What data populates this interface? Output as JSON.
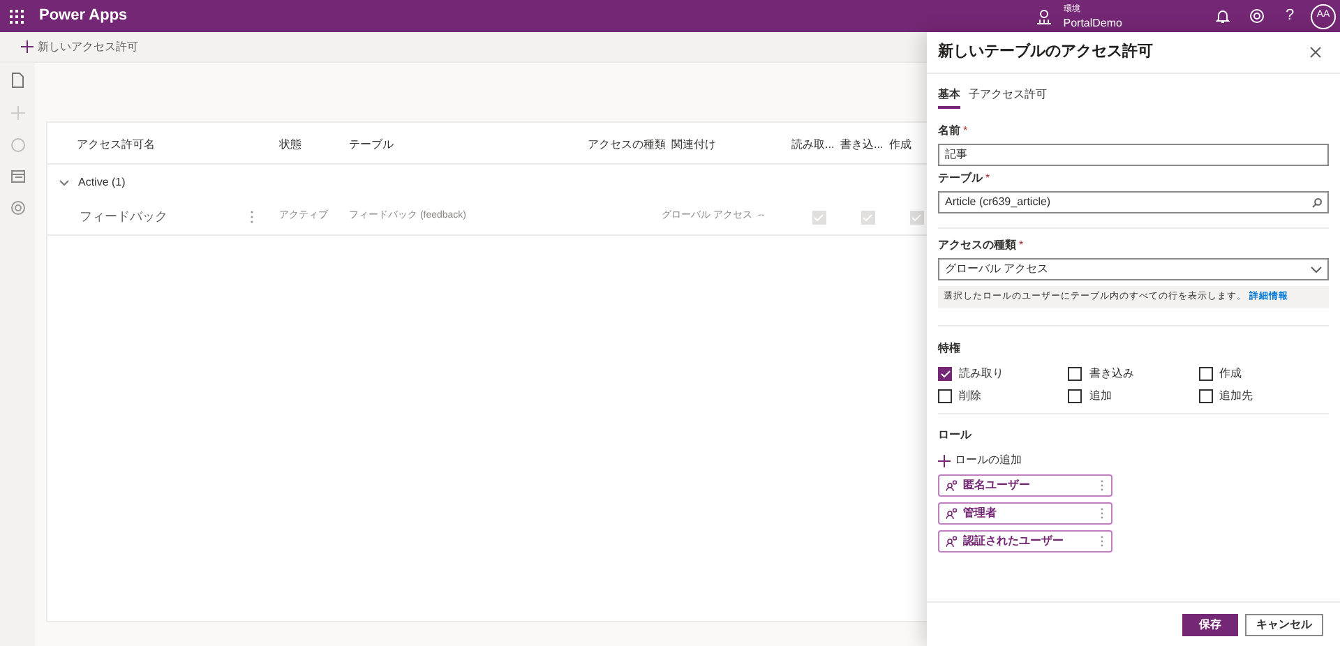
{
  "header": {
    "app_name": "Power Apps",
    "environment_label": "環境",
    "environment_name": "PortalDemo",
    "help": "?",
    "avatar": "AA"
  },
  "command_bar": {
    "new_button": "新しいアクセス許可"
  },
  "table": {
    "columns": [
      "アクセス許可名",
      "状態",
      "テーブル",
      "アクセスの種類",
      "関連付け",
      "読み取...",
      "書き込...",
      "作成"
    ],
    "group": {
      "label": "Active (1)",
      "expanded": true
    },
    "rows": [
      {
        "name": "フィードバック",
        "state": "アクティブ",
        "table": "フィードバック (feedback)",
        "access_type": "グローバル アクセス",
        "association": "--",
        "permissions": [
          {
            "checked": true
          },
          {
            "checked": true
          },
          {
            "checked": true
          }
        ]
      }
    ]
  },
  "panel": {
    "title": "新しいテーブルのアクセス許可",
    "tabs": [
      {
        "label": "基本",
        "selected": true
      },
      {
        "label": "子アクセス許可",
        "selected": false
      }
    ],
    "fields": [
      {
        "kind": "text",
        "label": "名前",
        "required_mark": "*",
        "value": "記事"
      },
      {
        "kind": "lookup",
        "label": "テーブル",
        "required_mark": "*",
        "value": "Article (cr639_article)"
      },
      {
        "kind": "dropdown",
        "label": "アクセスの種類",
        "required_mark": "*",
        "value": "グローバル アクセス"
      }
    ],
    "info": {
      "text": "選択したロールのユーザーにテーブル内のすべての行を表示します。",
      "link": "詳細情報"
    },
    "privileges": {
      "title": "特権",
      "items": [
        {
          "label": "読み取り",
          "checked": true
        },
        {
          "label": "書き込み",
          "checked": false
        },
        {
          "label": "作成",
          "checked": false
        },
        {
          "label": "削除",
          "checked": false
        },
        {
          "label": "追加",
          "checked": false
        },
        {
          "label": "追加先",
          "checked": false
        }
      ]
    },
    "roles": {
      "title": "ロール",
      "add_label": "ロールの追加",
      "items": [
        "匿名ユーザー",
        "管理者",
        "認証されたユーザー"
      ]
    },
    "buttons": {
      "save": "保存",
      "cancel": "キャンセル"
    }
  }
}
